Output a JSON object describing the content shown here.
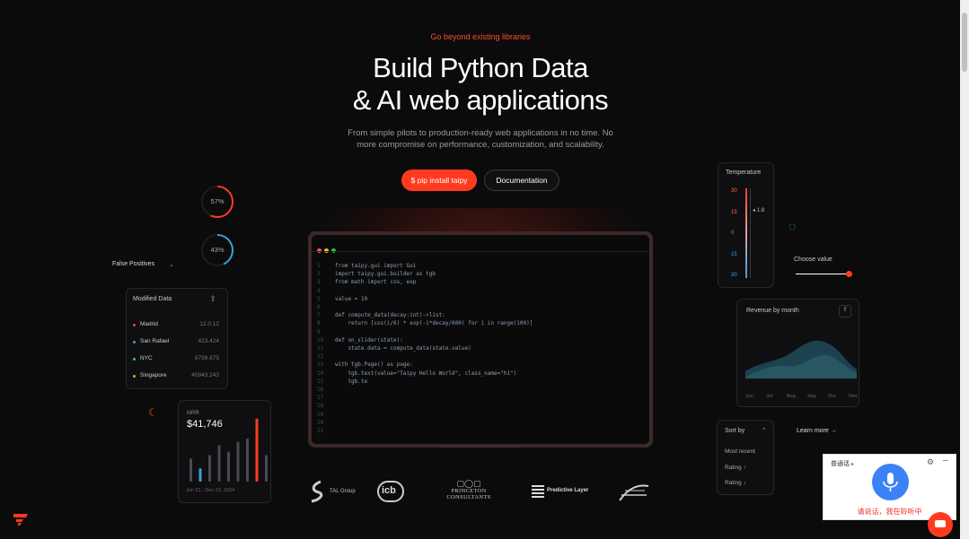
{
  "hero": {
    "eyebrow": "Go beyond existing libraries",
    "title_line1": "Build Python Data",
    "title_line2": "& AI web applications",
    "subtitle_line1": "From simple pilots to production-ready web applications in no time. No",
    "subtitle_line2": "more compromise on performance, customization, and scalability.",
    "primary_button": "$ pip install taipy",
    "secondary_button": "Documentation"
  },
  "gauges": [
    {
      "label": "57%",
      "value": 0.57,
      "color": "#ff3b1f"
    },
    {
      "label": "43%",
      "value": 0.43,
      "color": "#3aa0d8"
    }
  ],
  "false_positives": {
    "label": "False Positives"
  },
  "modified_data": {
    "title": "Modified Data",
    "rows": [
      {
        "city": "Madrid",
        "value": "12.0.12",
        "color": "#ff3b1f"
      },
      {
        "city": "San Rafael",
        "value": "423.424",
        "color": "#3aa0d8"
      },
      {
        "city": "NYC",
        "value": "6799.675",
        "color": "#39c77a"
      },
      {
        "city": "Singapore",
        "value": "45943.243",
        "color": "#f0a030"
      }
    ]
  },
  "mrr": {
    "label": "MRR",
    "value": "$41,746",
    "date_range": "Jun 21 - Dec 22, 2024",
    "bars": [
      0.35,
      0.2,
      0.4,
      0.55,
      0.45,
      0.6,
      0.65,
      0.95,
      0.4
    ],
    "highlight_blue": 1,
    "highlight_red": 7
  },
  "editor": {
    "lines": [
      {
        "n": "1",
        "t": "from taipy.gui import Gui"
      },
      {
        "n": "2",
        "t": "import taipy.gui.builder as tgb"
      },
      {
        "n": "3",
        "t": "from math import cos, exp"
      },
      {
        "n": "4",
        "t": ""
      },
      {
        "n": "5",
        "t": "value = 10"
      },
      {
        "n": "6",
        "t": ""
      },
      {
        "n": "7",
        "t": "def compute_data(decay:int)->list:"
      },
      {
        "n": "8",
        "t": "    return [cos(i/6) * exp(-i*decay/600) for i in range(100)]"
      },
      {
        "n": "9",
        "t": ""
      },
      {
        "n": "10",
        "t": "def on_slider(state):"
      },
      {
        "n": "11",
        "t": "    state.data = compute_data(state.value)"
      },
      {
        "n": "12",
        "t": ""
      },
      {
        "n": "13",
        "t": "with tgb.Page() as page:"
      },
      {
        "n": "14",
        "t": "    tgb.text(value=\"Taipy Hello World\", class_name=\"h1\")"
      },
      {
        "n": "15",
        "t": "    tgb.te"
      },
      {
        "n": "16",
        "t": ""
      },
      {
        "n": "17",
        "t": ""
      },
      {
        "n": "18",
        "t": ""
      },
      {
        "n": "19",
        "t": ""
      },
      {
        "n": "20",
        "t": ""
      },
      {
        "n": "21",
        "t": ""
      }
    ]
  },
  "temperature": {
    "title": "Temperature",
    "ticks": [
      "30",
      "15",
      "0",
      "15",
      "30"
    ],
    "marker": "1.8"
  },
  "choose_value": {
    "label": "Choose value",
    "level": 0.8
  },
  "revenue": {
    "title": "Revenue by month",
    "months": [
      "Jun",
      "Jul",
      "Aug",
      "Sep",
      "Oct",
      "Nov"
    ]
  },
  "sort_by": {
    "label": "Sort by",
    "options": [
      "Most recent",
      "Rating ↑",
      "Rating ↓"
    ]
  },
  "learn_more": "Learn more →",
  "logos": [
    "TAL Group",
    "icb",
    "PRINCETON CONSULTANTS",
    "Predictive Layer"
  ],
  "voice_widget": {
    "lang": "普通话",
    "prompt": "请说话，我在聆听中"
  },
  "colors": {
    "accent": "#ff3b1f",
    "blue": "#3aa0d8",
    "bg": "#0b0b0c"
  }
}
